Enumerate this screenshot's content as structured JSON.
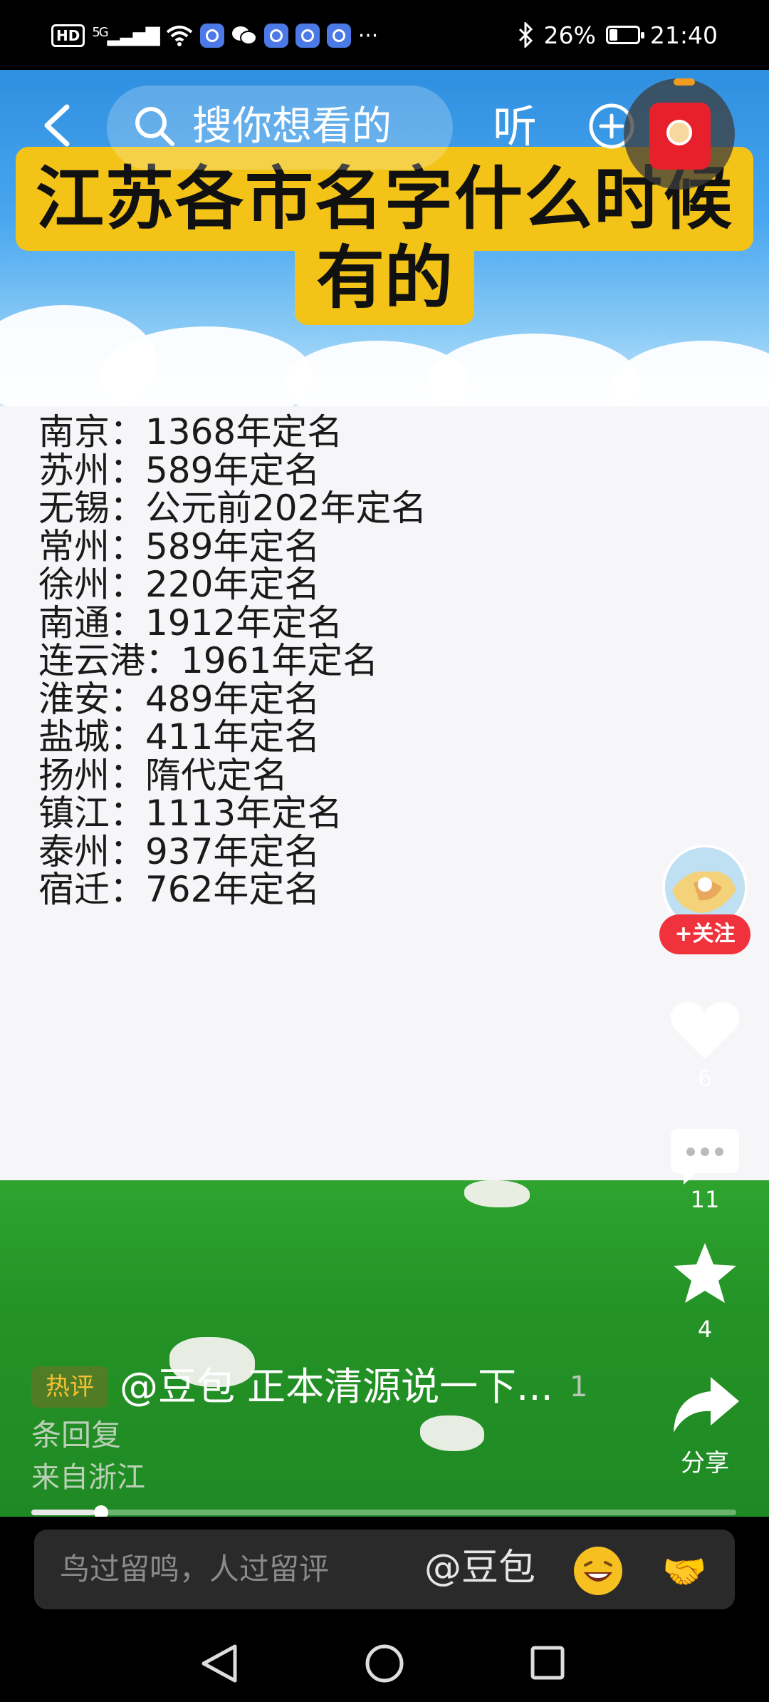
{
  "status_bar": {
    "hd": "HD",
    "network": "5G",
    "more": "···",
    "battery": "26%",
    "time": "21:40"
  },
  "top_bar": {
    "search_placeholder": "搜你想看的",
    "listen_label": "听"
  },
  "video": {
    "title_line1": "江苏各市名字什么时候",
    "title_line2": "有的",
    "rows": [
      "南京：1368年定名",
      "苏州：589年定名",
      "无锡：公元前202年定名",
      "常州：589年定名",
      "徐州：220年定名",
      "南通：1912年定名",
      "连云港：1961年定名",
      "淮安：489年定名",
      "盐城：411年定名",
      "扬州：隋代定名",
      "镇江：1113年定名",
      "泰州：937年定名",
      "宿迁：762年定名"
    ],
    "progress_fraction": 0.09
  },
  "side_rail": {
    "follow_label": "+关注",
    "like_count": "6",
    "comment_count": "11",
    "favorite_count": "4",
    "share_label": "分享"
  },
  "hot_comment": {
    "tag": "热评",
    "text": "@豆包 正本清源说一下...",
    "count": "1",
    "reply_suffix": "条回复",
    "location": "来自浙江"
  },
  "comment_bar": {
    "placeholder": "鸟过留鸣，人过留评",
    "mention": "@豆包",
    "emoji2": "🤝"
  },
  "colors": {
    "title_yellow": "#f3c317",
    "follow_red": "#f0323c",
    "hot_tag_gold": "#f5c131"
  }
}
